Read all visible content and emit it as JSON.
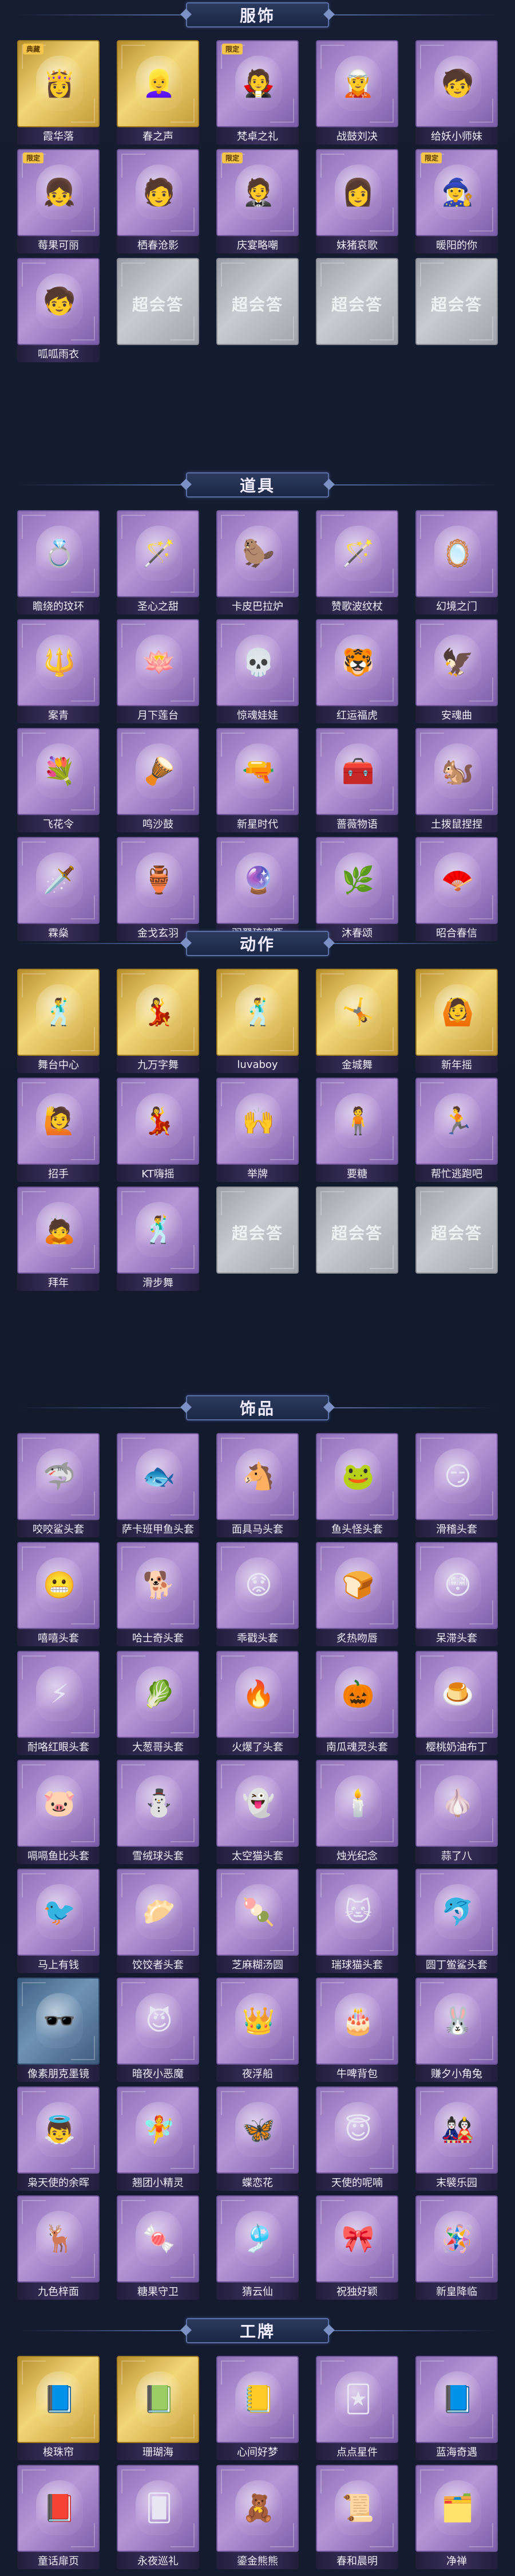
{
  "colors": {
    "background": "#141b2e",
    "banner": "#2b3a5e",
    "rarity_purple": "#b796d7",
    "rarity_gold": "#f2d777",
    "rarity_empty": "#c9cbd0"
  },
  "empty_logo_text": "超会答",
  "sections": [
    {
      "title": "服饰",
      "items": [
        {
          "label": "霞华落",
          "rarity": "gold",
          "icon": "female-portrait-icon",
          "glyph": "👸",
          "badge": "典藏"
        },
        {
          "label": "春之声",
          "rarity": "gold",
          "icon": "female-portrait-icon",
          "glyph": "👱‍♀️",
          "badge": ""
        },
        {
          "label": "梵卓之礼",
          "rarity": "purple",
          "icon": "masked-portrait-icon",
          "glyph": "🧛",
          "badge": "限定"
        },
        {
          "label": "战鼓刘决",
          "rarity": "purple",
          "icon": "hooded-portrait-icon",
          "glyph": "🧝",
          "badge": ""
        },
        {
          "label": "给妖小师妹",
          "rarity": "purple",
          "icon": "girl-portrait-icon",
          "glyph": "🧒",
          "badge": ""
        },
        {
          "label": "莓果可丽",
          "rarity": "purple",
          "icon": "girl-portrait-icon",
          "glyph": "👧",
          "badge": "限定"
        },
        {
          "label": "栖春沧影",
          "rarity": "purple",
          "icon": "male-portrait-icon",
          "glyph": "🧑",
          "badge": ""
        },
        {
          "label": "庆宴略嘲",
          "rarity": "purple",
          "icon": "male-portrait-icon",
          "glyph": "🤵",
          "badge": "限定"
        },
        {
          "label": "妹猪哀歌",
          "rarity": "purple",
          "icon": "girl-portrait-icon",
          "glyph": "👩",
          "badge": ""
        },
        {
          "label": "暖阳的你",
          "rarity": "purple",
          "icon": "witch-portrait-icon",
          "glyph": "🧙‍♀️",
          "badge": "限定"
        },
        {
          "label": "呱呱雨衣",
          "rarity": "purple",
          "icon": "child-portrait-icon",
          "glyph": "🧒",
          "badge": ""
        },
        {
          "label": "",
          "rarity": "empty",
          "icon": "",
          "glyph": "",
          "badge": ""
        },
        {
          "label": "",
          "rarity": "empty",
          "icon": "",
          "glyph": "",
          "badge": ""
        },
        {
          "label": "",
          "rarity": "empty",
          "icon": "",
          "glyph": "",
          "badge": ""
        },
        {
          "label": "",
          "rarity": "empty",
          "icon": "",
          "glyph": "",
          "badge": ""
        }
      ]
    },
    {
      "title": "道具",
      "items": [
        {
          "label": "瞻绕的玟环",
          "rarity": "purple",
          "icon": "ring-icon",
          "glyph": "💍",
          "badge": ""
        },
        {
          "label": "圣心之甜",
          "rarity": "purple",
          "icon": "scepter-icon",
          "glyph": "🪄",
          "badge": ""
        },
        {
          "label": "卡皮巴拉炉",
          "rarity": "purple",
          "icon": "capybara-icon",
          "glyph": "🦫",
          "badge": ""
        },
        {
          "label": "赞歌波纹杖",
          "rarity": "purple",
          "icon": "wand-icon",
          "glyph": "🪄",
          "badge": ""
        },
        {
          "label": "幻境之门",
          "rarity": "purple",
          "icon": "mirror-icon",
          "glyph": "🪞",
          "badge": ""
        },
        {
          "label": "案青",
          "rarity": "purple",
          "icon": "staff-icon",
          "glyph": "🔱",
          "badge": ""
        },
        {
          "label": "月下莲台",
          "rarity": "purple",
          "icon": "lotus-icon",
          "glyph": "🪷",
          "badge": ""
        },
        {
          "label": "惊魂娃娃",
          "rarity": "purple",
          "icon": "skull-doll-icon",
          "glyph": "💀",
          "badge": ""
        },
        {
          "label": "红运福虎",
          "rarity": "purple",
          "icon": "tiger-icon",
          "glyph": "🐯",
          "badge": ""
        },
        {
          "label": "安魂曲",
          "rarity": "purple",
          "icon": "bird-skull-icon",
          "glyph": "🦅",
          "badge": ""
        },
        {
          "label": "飞花令",
          "rarity": "purple",
          "icon": "flower-bouquet-icon",
          "glyph": "💐",
          "badge": ""
        },
        {
          "label": "鸣沙鼓",
          "rarity": "purple",
          "icon": "drum-icon",
          "glyph": "🪘",
          "badge": ""
        },
        {
          "label": "新星时代",
          "rarity": "purple",
          "icon": "pistol-icon",
          "glyph": "🔫",
          "badge": ""
        },
        {
          "label": "蔷薇物语",
          "rarity": "purple",
          "icon": "medkit-icon",
          "glyph": "🧰",
          "badge": ""
        },
        {
          "label": "土拨鼠捏捏",
          "rarity": "purple",
          "icon": "groundhog-icon",
          "glyph": "🐿️",
          "badge": ""
        },
        {
          "label": "霖燊",
          "rarity": "purple",
          "icon": "spear-icon",
          "glyph": "🗡️",
          "badge": ""
        },
        {
          "label": "金戈玄羽",
          "rarity": "purple",
          "icon": "bottle-icon",
          "glyph": "🏺",
          "badge": ""
        },
        {
          "label": "羽翠琉璃瓶",
          "rarity": "purple",
          "icon": "crystal-bottle-icon",
          "glyph": "🔮",
          "badge": ""
        },
        {
          "label": "沐春颂",
          "rarity": "purple",
          "icon": "branch-icon",
          "glyph": "🌿",
          "badge": ""
        },
        {
          "label": "昭合春信",
          "rarity": "purple",
          "icon": "fan-icon",
          "glyph": "🪭",
          "badge": ""
        }
      ]
    },
    {
      "title": "动作",
      "items": [
        {
          "label": "舞台中心",
          "rarity": "gold",
          "icon": "pose-figure-icon",
          "glyph": "🕺",
          "badge": ""
        },
        {
          "label": "九万字舞",
          "rarity": "gold",
          "icon": "pose-figure-icon",
          "glyph": "💃",
          "badge": ""
        },
        {
          "label": "luvaboy",
          "rarity": "gold",
          "icon": "pose-figure-icon",
          "glyph": "🕺",
          "badge": ""
        },
        {
          "label": "金城舞",
          "rarity": "gold",
          "icon": "pose-figure-icon",
          "glyph": "🤸",
          "badge": ""
        },
        {
          "label": "新年摇",
          "rarity": "gold",
          "icon": "pose-figure-icon",
          "glyph": "🙆",
          "badge": ""
        },
        {
          "label": "招手",
          "rarity": "purple",
          "icon": "pose-figure-icon",
          "glyph": "🙋",
          "badge": ""
        },
        {
          "label": "KT嗨摇",
          "rarity": "purple",
          "icon": "pose-figure-icon",
          "glyph": "💃",
          "badge": ""
        },
        {
          "label": "举牌",
          "rarity": "purple",
          "icon": "pose-figure-icon",
          "glyph": "🙌",
          "badge": ""
        },
        {
          "label": "要糖",
          "rarity": "purple",
          "icon": "pose-figure-icon",
          "glyph": "🧍",
          "badge": ""
        },
        {
          "label": "帮忙逃跑吧",
          "rarity": "purple",
          "icon": "pose-figure-icon",
          "glyph": "🏃",
          "badge": ""
        },
        {
          "label": "拜年",
          "rarity": "purple",
          "icon": "pose-figure-icon",
          "glyph": "🙇",
          "badge": ""
        },
        {
          "label": "滑步舞",
          "rarity": "purple",
          "icon": "pose-figure-icon",
          "glyph": "🕺",
          "badge": ""
        },
        {
          "label": "",
          "rarity": "empty",
          "icon": "",
          "glyph": "",
          "badge": ""
        },
        {
          "label": "",
          "rarity": "empty",
          "icon": "",
          "glyph": "",
          "badge": ""
        },
        {
          "label": "",
          "rarity": "empty",
          "icon": "",
          "glyph": "",
          "badge": ""
        }
      ]
    },
    {
      "title": "饰品",
      "items": [
        {
          "label": "咬咬鲨头套",
          "rarity": "purple",
          "icon": "shark-head-icon",
          "glyph": "🦈",
          "badge": ""
        },
        {
          "label": "萨卡班甲鱼头套",
          "rarity": "purple",
          "icon": "fish-head-icon",
          "glyph": "🐟",
          "badge": ""
        },
        {
          "label": "面具马头套",
          "rarity": "purple",
          "icon": "horse-head-icon",
          "glyph": "🐴",
          "badge": ""
        },
        {
          "label": "鱼头怪头套",
          "rarity": "purple",
          "icon": "frog-head-icon",
          "glyph": "🐸",
          "badge": ""
        },
        {
          "label": "滑稽头套",
          "rarity": "purple",
          "icon": "smiley-head-icon",
          "glyph": "😏",
          "badge": ""
        },
        {
          "label": "嘻嘻头套",
          "rarity": "purple",
          "icon": "grin-head-icon",
          "glyph": "😬",
          "badge": ""
        },
        {
          "label": "哈士奇头套",
          "rarity": "purple",
          "icon": "dog-head-icon",
          "glyph": "🐕",
          "badge": ""
        },
        {
          "label": "乖戳头套",
          "rarity": "purple",
          "icon": "pout-head-icon",
          "glyph": "😟",
          "badge": ""
        },
        {
          "label": "炙热吻唇",
          "rarity": "purple",
          "icon": "toast-head-icon",
          "glyph": "🍞",
          "badge": ""
        },
        {
          "label": "呆滞头套",
          "rarity": "purple",
          "icon": "dazed-head-icon",
          "glyph": "😳",
          "badge": ""
        },
        {
          "label": "耐咯红眼头套",
          "rarity": "purple",
          "icon": "pikachu-head-icon",
          "glyph": "⚡",
          "badge": ""
        },
        {
          "label": "大葱哥头套",
          "rarity": "purple",
          "icon": "onion-head-icon",
          "glyph": "🥬",
          "badge": ""
        },
        {
          "label": "火爆了头套",
          "rarity": "purple",
          "icon": "fire-head-icon",
          "glyph": "🔥",
          "badge": ""
        },
        {
          "label": "南瓜魂灵头套",
          "rarity": "purple",
          "icon": "pumpkin-head-icon",
          "glyph": "🎃",
          "badge": ""
        },
        {
          "label": "樱桃奶油布丁",
          "rarity": "purple",
          "icon": "pudding-head-icon",
          "glyph": "🍮",
          "badge": ""
        },
        {
          "label": "嗝嗝鱼比头套",
          "rarity": "purple",
          "icon": "pink-pig-head-icon",
          "glyph": "🐷",
          "badge": ""
        },
        {
          "label": "雪绒球头套",
          "rarity": "purple",
          "icon": "snowball-head-icon",
          "glyph": "⛄",
          "badge": ""
        },
        {
          "label": "太空猫头套",
          "rarity": "purple",
          "icon": "ghost-head-icon",
          "glyph": "👻",
          "badge": ""
        },
        {
          "label": "烛光纪念",
          "rarity": "purple",
          "icon": "candle-icon",
          "glyph": "🕯️",
          "badge": ""
        },
        {
          "label": "蒜了八",
          "rarity": "purple",
          "icon": "garlic-head-icon",
          "glyph": "🧄",
          "badge": ""
        },
        {
          "label": "马上有钱",
          "rarity": "purple",
          "icon": "bird-hat-icon",
          "glyph": "🐦",
          "badge": ""
        },
        {
          "label": "饺饺者头套",
          "rarity": "purple",
          "icon": "dumpling-head-icon",
          "glyph": "🥟",
          "badge": ""
        },
        {
          "label": "芝麻糊汤圆",
          "rarity": "purple",
          "icon": "dumpling-head-icon",
          "glyph": "🍡",
          "badge": ""
        },
        {
          "label": "瑞球猫头套",
          "rarity": "purple",
          "icon": "cat-head-icon",
          "glyph": "🐱",
          "badge": ""
        },
        {
          "label": "圆丁鲎鲨头套",
          "rarity": "purple",
          "icon": "blue-shark-head-icon",
          "glyph": "🐬",
          "badge": ""
        },
        {
          "label": "像素朋克墨镜",
          "rarity": "blue",
          "icon": "sunglasses-icon",
          "glyph": "🕶️",
          "badge": ""
        },
        {
          "label": "暗夜小恶魔",
          "rarity": "purple",
          "icon": "devil-head-icon",
          "glyph": "😈",
          "badge": ""
        },
        {
          "label": "夜浮船",
          "rarity": "purple",
          "icon": "crystal-crown-icon",
          "glyph": "👑",
          "badge": ""
        },
        {
          "label": "牛啤背包",
          "rarity": "purple",
          "icon": "cake-backpack-icon",
          "glyph": "🎂",
          "badge": ""
        },
        {
          "label": "赚夕小角兔",
          "rarity": "purple",
          "icon": "blue-rabbit-icon",
          "glyph": "🐰",
          "badge": ""
        },
        {
          "label": "枭天使的余晖",
          "rarity": "purple",
          "icon": "angel-figure-icon",
          "glyph": "👼",
          "badge": ""
        },
        {
          "label": "翘团小精灵",
          "rarity": "purple",
          "icon": "fairy-figure-icon",
          "glyph": "🧚",
          "badge": ""
        },
        {
          "label": "蝶恋花",
          "rarity": "purple",
          "icon": "fairy-figure-icon",
          "glyph": "🦋",
          "badge": ""
        },
        {
          "label": "天使的呢喃",
          "rarity": "purple",
          "icon": "angel-figure-icon",
          "glyph": "😇",
          "badge": ""
        },
        {
          "label": "末襞乐园",
          "rarity": "purple",
          "icon": "doll-figure-icon",
          "glyph": "🎎",
          "badge": ""
        },
        {
          "label": "九色梓面",
          "rarity": "purple",
          "icon": "deer-charm-icon",
          "glyph": "🦌",
          "badge": ""
        },
        {
          "label": "糖果守卫",
          "rarity": "purple",
          "icon": "charm-pendant-icon",
          "glyph": "🍬",
          "badge": ""
        },
        {
          "label": "猜云仙",
          "rarity": "purple",
          "icon": "charm-pendant-icon",
          "glyph": "🎐",
          "badge": ""
        },
        {
          "label": "祝独好颖",
          "rarity": "purple",
          "icon": "charm-pendant-icon",
          "glyph": "🎀",
          "badge": ""
        },
        {
          "label": "新皇降临",
          "rarity": "purple",
          "icon": "charm-pendant-icon",
          "glyph": "🪅",
          "badge": ""
        }
      ]
    },
    {
      "title": "工牌",
      "items": [
        {
          "label": "梭珠帘",
          "rarity": "gold",
          "icon": "badge-card-icon",
          "glyph": "📘",
          "badge": ""
        },
        {
          "label": "珊瑚海",
          "rarity": "gold",
          "icon": "badge-card-icon",
          "glyph": "📗",
          "badge": ""
        },
        {
          "label": "心间好梦",
          "rarity": "purple",
          "icon": "badge-card-icon",
          "glyph": "📒",
          "badge": ""
        },
        {
          "label": "点点星件",
          "rarity": "purple",
          "icon": "badge-card-icon",
          "glyph": "🃏",
          "badge": ""
        },
        {
          "label": "蓝海奇遇",
          "rarity": "purple",
          "icon": "badge-card-icon",
          "glyph": "📘",
          "badge": ""
        },
        {
          "label": "童话扉页",
          "rarity": "purple",
          "icon": "badge-card-icon",
          "glyph": "📕",
          "badge": ""
        },
        {
          "label": "永夜巡礼",
          "rarity": "purple",
          "icon": "badge-card-icon",
          "glyph": "🂠",
          "badge": ""
        },
        {
          "label": "鎏金熊熊",
          "rarity": "purple",
          "icon": "badge-card-icon",
          "glyph": "🧸",
          "badge": ""
        },
        {
          "label": "春和晨明",
          "rarity": "purple",
          "icon": "badge-card-icon",
          "glyph": "📜",
          "badge": ""
        },
        {
          "label": "净禅",
          "rarity": "purple",
          "icon": "badge-card-icon",
          "glyph": "🗂️",
          "badge": ""
        }
      ]
    }
  ]
}
